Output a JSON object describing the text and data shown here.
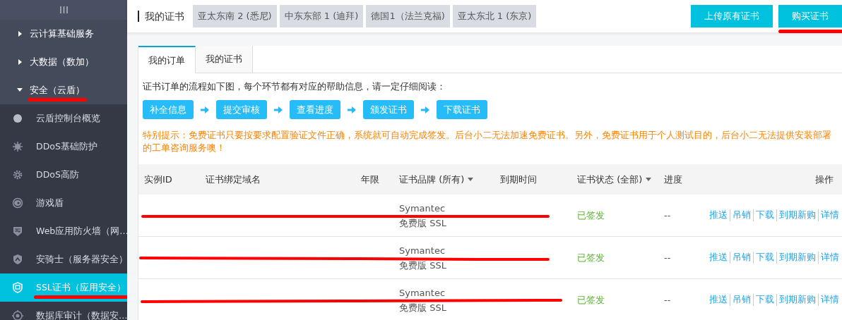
{
  "sidebar": {
    "groups": [
      {
        "label": "云计算基础服务",
        "expanded": false,
        "annotated": false
      },
      {
        "label": "大数据（数加）",
        "expanded": false,
        "annotated": false
      },
      {
        "label": "安全（云盾）",
        "expanded": true,
        "annotated": true,
        "children": [
          {
            "label": "云盾控制台概览",
            "selected": false,
            "annotated": false
          },
          {
            "label": "DDoS基础防护",
            "selected": false,
            "annotated": false
          },
          {
            "label": "DDoS高防",
            "selected": false,
            "annotated": false
          },
          {
            "label": "游戏盾",
            "selected": false,
            "annotated": false
          },
          {
            "label": "Web应用防火墙（网…",
            "selected": false,
            "annotated": false
          },
          {
            "label": "安骑士（服务器安全）",
            "selected": false,
            "annotated": false
          },
          {
            "label": "SSL证书（应用安全）",
            "selected": true,
            "annotated": true
          },
          {
            "label": "数据库审计（数据安…",
            "selected": false,
            "annotated": false
          }
        ]
      }
    ]
  },
  "header": {
    "title": "我的证书",
    "regions": [
      "亚太东南 2 (悉尼)",
      "中东东部 1 (迪拜)",
      "德国1（法兰克福)",
      "亚太东北 1 (东京)"
    ],
    "buttons": [
      {
        "label": "上传原有证书",
        "annotated": false
      },
      {
        "label": "购买证书",
        "annotated": true
      }
    ]
  },
  "tabs": [
    {
      "label": "我的订单",
      "selected": true
    },
    {
      "label": "我的证书",
      "selected": false
    }
  ],
  "intro": "证书订单的流程如下图，每个环节都有对应的帮助信息，请一定仔细阅读：",
  "steps": [
    "补全信息",
    "提交审核",
    "查看进度",
    "颁发证书",
    "下载证书"
  ],
  "notice": "特别提示：免费证书只要按要求配置验证文件正确，系统就可自动完成签发。后台小二无法加速免费证书。另外，免费证书用于个人测试目的，后台小二无法提供安装部署的工单咨询服务噢！",
  "table": {
    "columns": [
      {
        "label": "实例ID",
        "filter": false
      },
      {
        "label": "证书绑定域名",
        "filter": false
      },
      {
        "label": "年限",
        "filter": false
      },
      {
        "label": "证书品牌 (所有)",
        "filter": true
      },
      {
        "label": "到期时间",
        "filter": false
      },
      {
        "label": "证书状态 (全部)",
        "filter": true
      },
      {
        "label": "进度",
        "filter": false
      },
      {
        "label": "操作",
        "filter": false
      }
    ],
    "rows": [
      {
        "brand": [
          "Symantec",
          "免费版 SSL"
        ],
        "status": "已签发",
        "progress": "--",
        "actions": [
          "推送",
          "吊销",
          "下载",
          "到期新购",
          "详情"
        ],
        "redacted": true
      },
      {
        "brand": [
          "Symantec",
          "免费版 SSL"
        ],
        "status": "已签发",
        "progress": "--",
        "actions": [
          "推送",
          "吊销",
          "下载",
          "到期新购",
          "详情"
        ],
        "redacted": true
      },
      {
        "brand": [
          "Symantec",
          "免费版 SSL"
        ],
        "status": "已签发",
        "progress": "--",
        "actions": [
          "推送",
          "吊销",
          "下载",
          "到期新购",
          "详情"
        ],
        "redacted": true
      }
    ]
  }
}
